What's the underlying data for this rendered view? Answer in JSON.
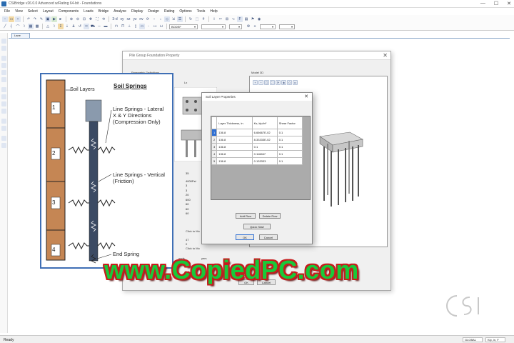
{
  "window": {
    "title": "CSiBridge v26.0.0 Advanced w/Rating 64-bit - Foundations",
    "minimize": "—",
    "maximize": "☐",
    "close": "✕"
  },
  "menu": [
    "File",
    "View",
    "Select",
    "Layout",
    "Components",
    "Loads",
    "Bridge",
    "Analyze",
    "Display",
    "Design",
    "Rating",
    "Options",
    "Tools",
    "Help"
  ],
  "toolbar": {
    "group_select": "BODEF",
    "coord_buttons": [
      "3-d",
      "xy",
      "xz",
      "yz",
      "nv"
    ]
  },
  "tab": {
    "label": "Lane"
  },
  "pile_dialog": {
    "title": "Pile Group Foundation Property",
    "parametric_label": "Parametric Definitions",
    "model3d_label": "Model 3D",
    "lx_label": "Lx",
    "params": [
      "35",
      "4000Psi",
      "3",
      "3",
      "20",
      "600",
      "60",
      "60",
      "60"
    ],
    "click_to_modify_1": "Click to Mo",
    "soil_values": [
      "47",
      "0"
    ],
    "click_to_modify_2": "Click to Mo",
    "soil_loads_label": "oads",
    "layers_label": "yers",
    "ok": "OK",
    "cancel": "Cancel"
  },
  "soil_dialog": {
    "title": "Soil Layer Properties",
    "close": "✕",
    "headers": [
      "Layer Thickness, in",
      "Ks, kip/in²",
      "Shear Factor"
    ],
    "rows": [
      {
        "n": "1",
        "thickness": "136.8",
        "ks": "6.66667E-02",
        "shear": "0.1"
      },
      {
        "n": "2",
        "thickness": "136.8",
        "ks": "8.33333E-02",
        "shear": "0.1"
      },
      {
        "n": "3",
        "thickness": "136.8",
        "ks": "0.1",
        "shear": "0.1"
      },
      {
        "n": "4",
        "thickness": "136.8",
        "ks": "0.116667",
        "shear": "0.1"
      },
      {
        "n": "5",
        "thickness": "136.8",
        "ks": "0.133333",
        "shear": "0.1"
      }
    ],
    "add_row": "Add Row",
    "delete_row": "Delete Row",
    "quick_start": "Quick Start",
    "ok": "OK",
    "cancel": "Cancel"
  },
  "soil_figure": {
    "title": "Soil Springs",
    "soil_layers": "Soil Layers",
    "layer_numbers": [
      "1",
      "2",
      "3",
      "4"
    ],
    "lateral_line1": "Line Springs - Lateral",
    "lateral_line2": "X & Y Directions",
    "lateral_line3": "(Compression Only)",
    "vertical_line1": "Line Springs - Vertical",
    "vertical_line2": "(Friction)",
    "end_spring": "End Spring"
  },
  "overlay": {
    "watermark": "www.CopiedPC.com"
  },
  "status": {
    "ready": "Ready",
    "coord_system": "GLOBAL",
    "units": "Kip, in, F"
  },
  "colors": {
    "soil": "#c58654",
    "selection": "#2e6fd3",
    "overlay_fill": "#19c93a",
    "overlay_outline": "#c51d1d",
    "figure_border": "#3f6fb5"
  }
}
